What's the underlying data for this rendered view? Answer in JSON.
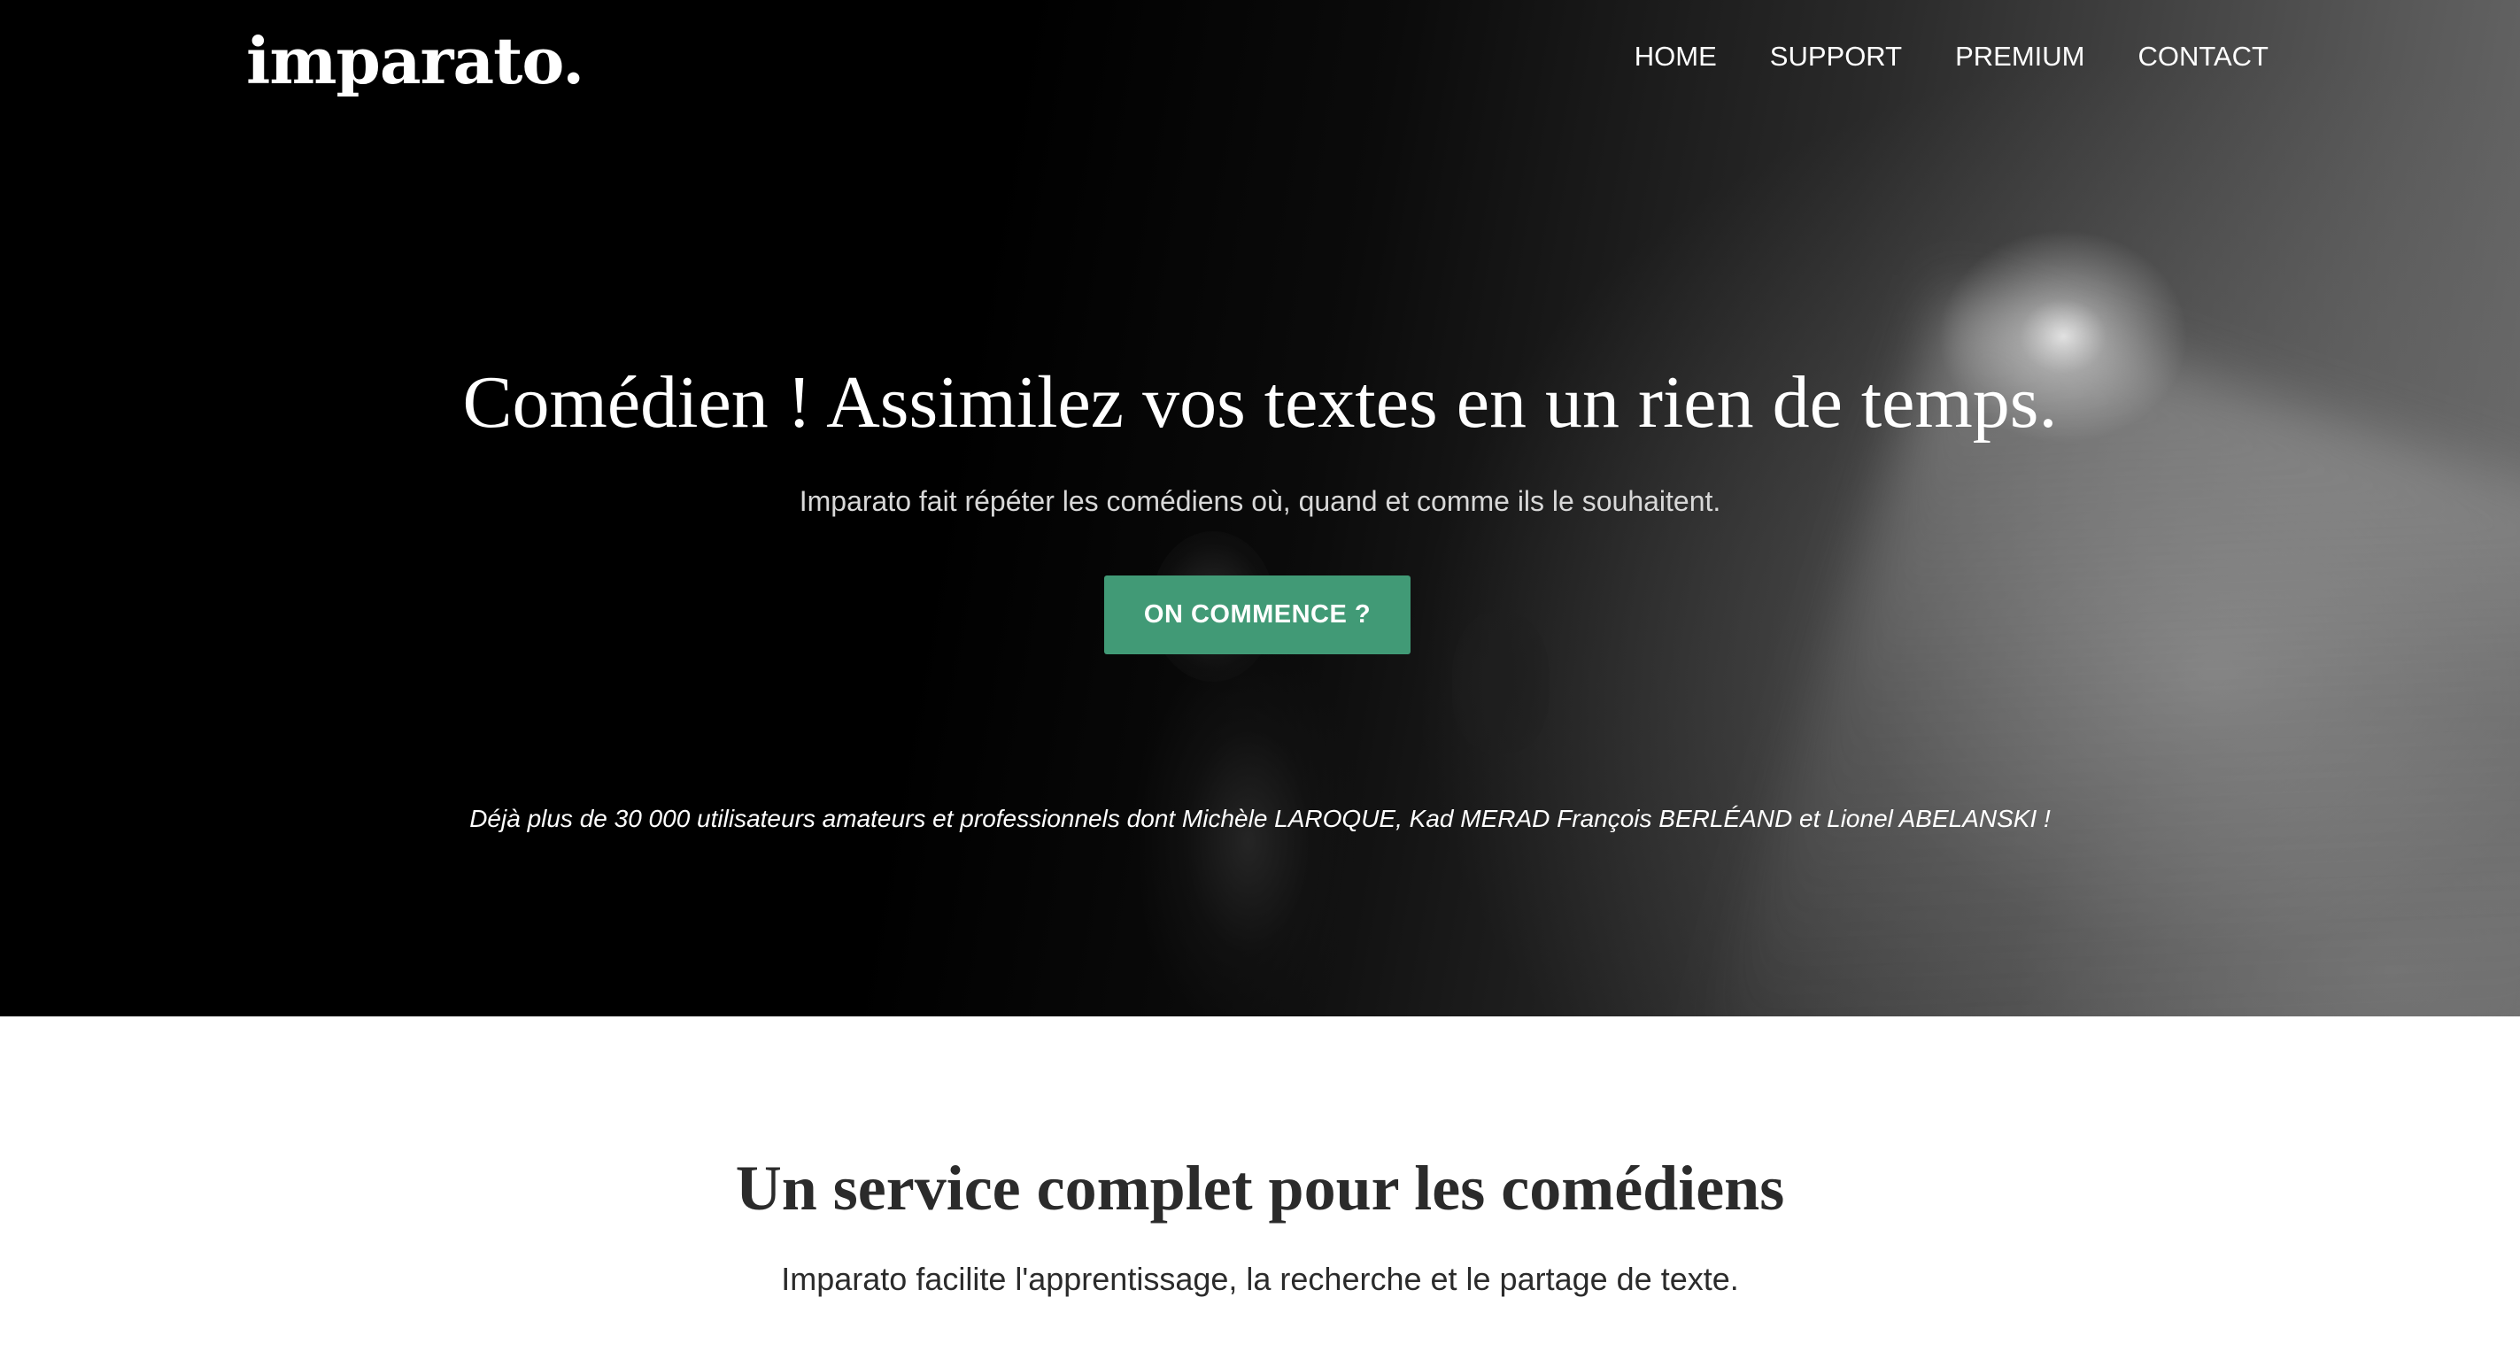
{
  "header": {
    "logo": "imparato.",
    "nav": [
      {
        "label": "HOME"
      },
      {
        "label": "SUPPORT"
      },
      {
        "label": "PREMIUM"
      },
      {
        "label": "CONTACT"
      }
    ]
  },
  "hero": {
    "title": "Comédien ! Assimilez vos textes en un rien de temps.",
    "subtitle": "Imparato fait répéter les comédiens où, quand et comme ils le souhaitent.",
    "cta_label": "ON COMMENCE ?",
    "users_line": "Déjà plus de 30 000 utilisateurs amateurs et professionnels dont Michèle LAROQUE, Kad MERAD François BERLÉAND et Lionel ABELANSKI !"
  },
  "service": {
    "title": "Un service complet pour les comédiens",
    "subtitle": "Imparato facilite l'apprentissage, la recherche et le partage de texte."
  },
  "colors": {
    "accent": "#419a76",
    "hero_background": "#000000",
    "text_dark": "#2b2b2b"
  }
}
